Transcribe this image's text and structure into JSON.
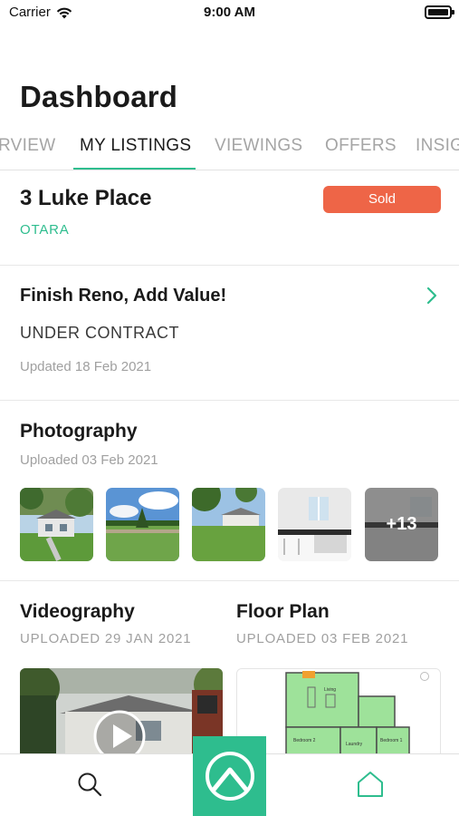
{
  "status_bar": {
    "carrier": "Carrier",
    "time": "9:00 AM"
  },
  "page": {
    "title": "Dashboard"
  },
  "tabs": [
    {
      "label": "RVIEW",
      "active": false
    },
    {
      "label": "MY LISTINGS",
      "active": true
    },
    {
      "label": "VIEWINGS",
      "active": false
    },
    {
      "label": "OFFERS",
      "active": false
    },
    {
      "label": "INSIG",
      "active": false
    }
  ],
  "property": {
    "address": "3 Luke Place",
    "suburb": "OTARA",
    "status_badge": "Sold"
  },
  "listing": {
    "title": "Finish Reno, Add Value!",
    "status": "UNDER CONTRACT",
    "updated": "Updated 18 Feb 2021"
  },
  "photography": {
    "title": "Photography",
    "uploaded": "Uploaded 03 Feb 2021",
    "more_count": "+13"
  },
  "videography": {
    "title": "Videography",
    "uploaded": "UPLOADED 29 JAN 2021"
  },
  "floor_plan": {
    "title": "Floor Plan",
    "uploaded": "UPLOADED 03 FEB 2021",
    "rooms": [
      "Living",
      "Bedroom 2",
      "Laundry",
      "Bedroom 1"
    ]
  },
  "colors": {
    "accent": "#2ebd8e",
    "sold": "#ee6547",
    "muted": "#a0a0a0"
  },
  "bottom_nav": {
    "icons": [
      "search-icon",
      "app-logo-icon",
      "home-icon"
    ]
  }
}
